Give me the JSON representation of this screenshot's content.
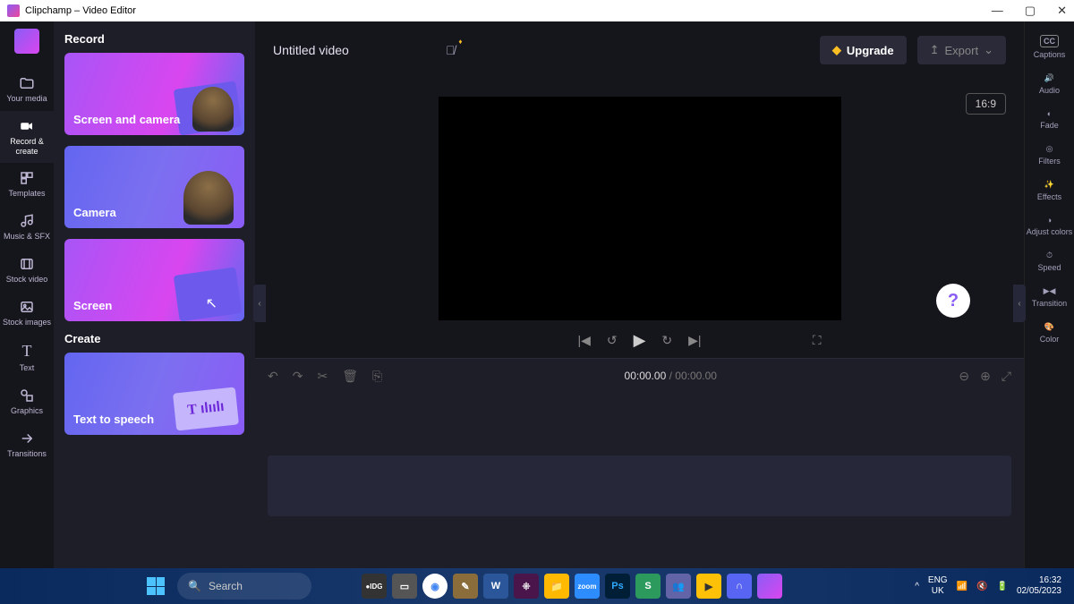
{
  "window": {
    "title": "Clipchamp – Video Editor"
  },
  "sidebar_left": [
    {
      "label": "Your media"
    },
    {
      "label": "Record & create"
    },
    {
      "label": "Templates"
    },
    {
      "label": "Music & SFX"
    },
    {
      "label": "Stock video"
    },
    {
      "label": "Stock images"
    },
    {
      "label": "Text"
    },
    {
      "label": "Graphics"
    },
    {
      "label": "Transitions"
    }
  ],
  "panel": {
    "record_heading": "Record",
    "create_heading": "Create",
    "cards": {
      "screen_and_camera": "Screen and camera",
      "camera": "Camera",
      "screen": "Screen",
      "text_to_speech": "Text to speech"
    }
  },
  "topbar": {
    "title": "Untitled video",
    "upgrade": "Upgrade",
    "export": "Export",
    "aspect": "16:9"
  },
  "timeline": {
    "current": "00:00.00",
    "duration": "00:00.00"
  },
  "sidebar_right": [
    "Captions",
    "Audio",
    "Fade",
    "Filters",
    "Effects",
    "Adjust colors",
    "Speed",
    "Transition",
    "Color"
  ],
  "taskbar": {
    "search": "Search",
    "lang1": "ENG",
    "lang2": "UK",
    "time": "16:32",
    "date": "02/05/2023"
  }
}
